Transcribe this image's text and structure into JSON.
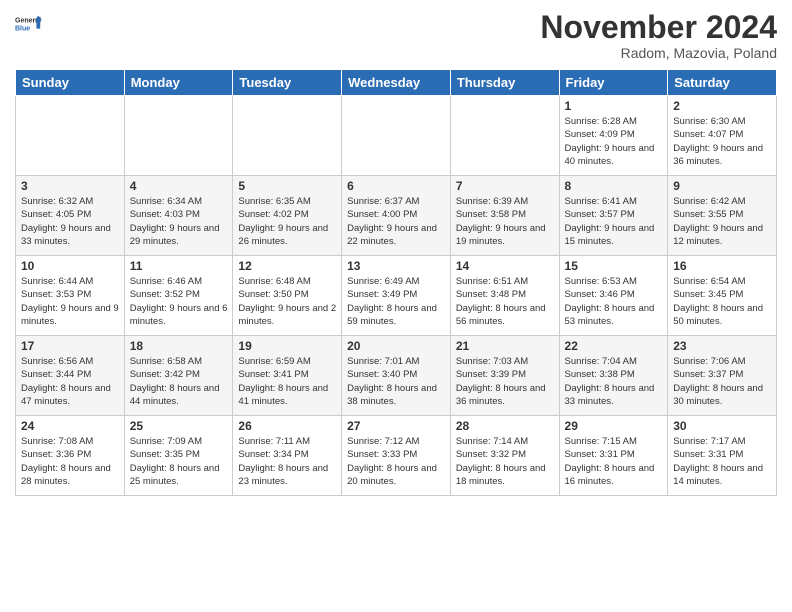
{
  "logo": {
    "line1": "General",
    "line2": "Blue"
  },
  "title": "November 2024",
  "subtitle": "Radom, Mazovia, Poland",
  "weekdays": [
    "Sunday",
    "Monday",
    "Tuesday",
    "Wednesday",
    "Thursday",
    "Friday",
    "Saturday"
  ],
  "weeks": [
    [
      {
        "day": "",
        "info": ""
      },
      {
        "day": "",
        "info": ""
      },
      {
        "day": "",
        "info": ""
      },
      {
        "day": "",
        "info": ""
      },
      {
        "day": "",
        "info": ""
      },
      {
        "day": "1",
        "info": "Sunrise: 6:28 AM\nSunset: 4:09 PM\nDaylight: 9 hours and 40 minutes."
      },
      {
        "day": "2",
        "info": "Sunrise: 6:30 AM\nSunset: 4:07 PM\nDaylight: 9 hours and 36 minutes."
      }
    ],
    [
      {
        "day": "3",
        "info": "Sunrise: 6:32 AM\nSunset: 4:05 PM\nDaylight: 9 hours and 33 minutes."
      },
      {
        "day": "4",
        "info": "Sunrise: 6:34 AM\nSunset: 4:03 PM\nDaylight: 9 hours and 29 minutes."
      },
      {
        "day": "5",
        "info": "Sunrise: 6:35 AM\nSunset: 4:02 PM\nDaylight: 9 hours and 26 minutes."
      },
      {
        "day": "6",
        "info": "Sunrise: 6:37 AM\nSunset: 4:00 PM\nDaylight: 9 hours and 22 minutes."
      },
      {
        "day": "7",
        "info": "Sunrise: 6:39 AM\nSunset: 3:58 PM\nDaylight: 9 hours and 19 minutes."
      },
      {
        "day": "8",
        "info": "Sunrise: 6:41 AM\nSunset: 3:57 PM\nDaylight: 9 hours and 15 minutes."
      },
      {
        "day": "9",
        "info": "Sunrise: 6:42 AM\nSunset: 3:55 PM\nDaylight: 9 hours and 12 minutes."
      }
    ],
    [
      {
        "day": "10",
        "info": "Sunrise: 6:44 AM\nSunset: 3:53 PM\nDaylight: 9 hours and 9 minutes."
      },
      {
        "day": "11",
        "info": "Sunrise: 6:46 AM\nSunset: 3:52 PM\nDaylight: 9 hours and 6 minutes."
      },
      {
        "day": "12",
        "info": "Sunrise: 6:48 AM\nSunset: 3:50 PM\nDaylight: 9 hours and 2 minutes."
      },
      {
        "day": "13",
        "info": "Sunrise: 6:49 AM\nSunset: 3:49 PM\nDaylight: 8 hours and 59 minutes."
      },
      {
        "day": "14",
        "info": "Sunrise: 6:51 AM\nSunset: 3:48 PM\nDaylight: 8 hours and 56 minutes."
      },
      {
        "day": "15",
        "info": "Sunrise: 6:53 AM\nSunset: 3:46 PM\nDaylight: 8 hours and 53 minutes."
      },
      {
        "day": "16",
        "info": "Sunrise: 6:54 AM\nSunset: 3:45 PM\nDaylight: 8 hours and 50 minutes."
      }
    ],
    [
      {
        "day": "17",
        "info": "Sunrise: 6:56 AM\nSunset: 3:44 PM\nDaylight: 8 hours and 47 minutes."
      },
      {
        "day": "18",
        "info": "Sunrise: 6:58 AM\nSunset: 3:42 PM\nDaylight: 8 hours and 44 minutes."
      },
      {
        "day": "19",
        "info": "Sunrise: 6:59 AM\nSunset: 3:41 PM\nDaylight: 8 hours and 41 minutes."
      },
      {
        "day": "20",
        "info": "Sunrise: 7:01 AM\nSunset: 3:40 PM\nDaylight: 8 hours and 38 minutes."
      },
      {
        "day": "21",
        "info": "Sunrise: 7:03 AM\nSunset: 3:39 PM\nDaylight: 8 hours and 36 minutes."
      },
      {
        "day": "22",
        "info": "Sunrise: 7:04 AM\nSunset: 3:38 PM\nDaylight: 8 hours and 33 minutes."
      },
      {
        "day": "23",
        "info": "Sunrise: 7:06 AM\nSunset: 3:37 PM\nDaylight: 8 hours and 30 minutes."
      }
    ],
    [
      {
        "day": "24",
        "info": "Sunrise: 7:08 AM\nSunset: 3:36 PM\nDaylight: 8 hours and 28 minutes."
      },
      {
        "day": "25",
        "info": "Sunrise: 7:09 AM\nSunset: 3:35 PM\nDaylight: 8 hours and 25 minutes."
      },
      {
        "day": "26",
        "info": "Sunrise: 7:11 AM\nSunset: 3:34 PM\nDaylight: 8 hours and 23 minutes."
      },
      {
        "day": "27",
        "info": "Sunrise: 7:12 AM\nSunset: 3:33 PM\nDaylight: 8 hours and 20 minutes."
      },
      {
        "day": "28",
        "info": "Sunrise: 7:14 AM\nSunset: 3:32 PM\nDaylight: 8 hours and 18 minutes."
      },
      {
        "day": "29",
        "info": "Sunrise: 7:15 AM\nSunset: 3:31 PM\nDaylight: 8 hours and 16 minutes."
      },
      {
        "day": "30",
        "info": "Sunrise: 7:17 AM\nSunset: 3:31 PM\nDaylight: 8 hours and 14 minutes."
      }
    ]
  ]
}
